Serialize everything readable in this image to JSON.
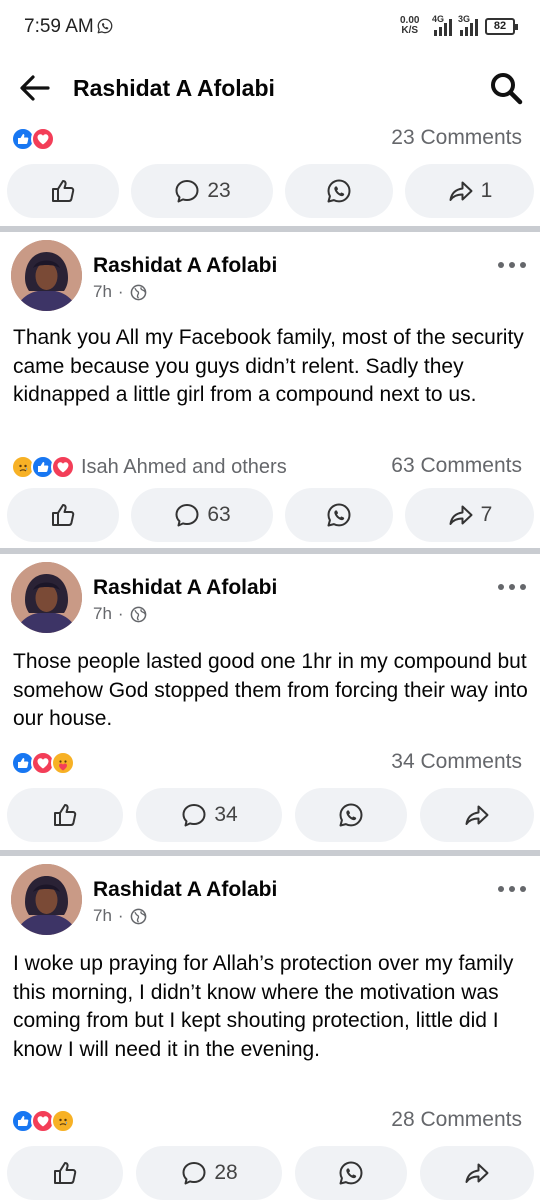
{
  "status_bar": {
    "time": "7:59 AM",
    "net_speed_value": "0.00",
    "net_speed_unit": "K/S",
    "signal_1": "4G",
    "signal_2": "3G",
    "battery": "82"
  },
  "header": {
    "title": "Rashidat A Afolabi"
  },
  "posts": [
    {
      "comments_label": "23 Comments",
      "reactions": [
        "like",
        "love"
      ],
      "reaction_names": "",
      "comment_count": "23",
      "share_count": "1"
    },
    {
      "author": "Rashidat A Afolabi",
      "time": "7h",
      "separator": "·",
      "text": "Thank you All my Facebook family, most of the security came because you guys didn’t relent. Sadly they kidnapped a little girl from a compound next to us.",
      "reactions": [
        "sad",
        "like",
        "love"
      ],
      "reaction_names": "Isah Ahmed and others",
      "comments_label": "63 Comments",
      "comment_count": "63",
      "share_count": "7"
    },
    {
      "author": "Rashidat A Afolabi",
      "time": "7h",
      "separator": "·",
      "text": "Those people lasted good one 1hr in my compound but somehow God stopped them from forcing their way into our house.",
      "reactions": [
        "like",
        "love",
        "care"
      ],
      "reaction_names": "",
      "comments_label": "34 Comments",
      "comment_count": "34",
      "share_count": ""
    },
    {
      "author": "Rashidat A Afolabi",
      "time": "7h",
      "separator": "·",
      "text": "I woke up praying for Allah’s protection over my family this morning, I didn’t know where the motivation was coming from but I kept shouting protection, little did I know I will need it in the evening.",
      "reactions": [
        "like",
        "love",
        "sad"
      ],
      "reaction_names": "",
      "comments_label": "28 Comments",
      "comment_count": "28",
      "share_count": ""
    }
  ],
  "colors": {
    "like": "#1877f2",
    "love": "#f33e58",
    "emoji": "#f7b125",
    "secondary_text": "#65676b",
    "button_bg": "#f0f2f5",
    "divider": "#c9ccd1"
  },
  "icons": [
    "back-arrow-icon",
    "search-icon",
    "like-icon",
    "comment-icon",
    "whatsapp-icon",
    "share-icon",
    "more-icon",
    "globe-icon"
  ]
}
